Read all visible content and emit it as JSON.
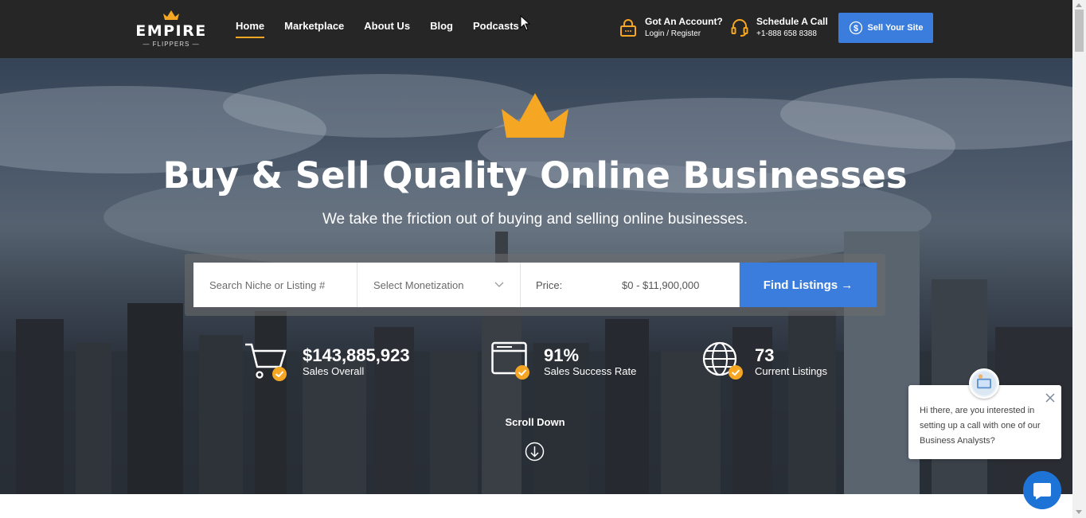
{
  "brand": {
    "name": "EMPIRE",
    "tagline": "— FLIPPERS —",
    "accent": "#f5a623",
    "primary": "#3b7ddd"
  },
  "nav": {
    "links": [
      {
        "label": "Home",
        "active": true
      },
      {
        "label": "Marketplace",
        "active": false
      },
      {
        "label": "About Us",
        "active": false
      },
      {
        "label": "Blog",
        "active": false
      },
      {
        "label": "Podcasts",
        "active": false
      }
    ],
    "account": {
      "title": "Got An Account?",
      "sub": "Login / Register",
      "icon": "lock-icon"
    },
    "call": {
      "title": "Schedule A Call",
      "sub": "+1-888 658 8388",
      "icon": "headset-icon"
    },
    "sell_button": "Sell Your Site"
  },
  "hero": {
    "title": "Buy & Sell Quality Online Businesses",
    "subtitle": "We take the friction out of buying and selling online businesses."
  },
  "search": {
    "placeholder": "Search Niche or Listing #",
    "monetization": "Select Monetization",
    "price_label": "Price:",
    "price_range": "$0 - $11,900,000",
    "button": "Find Listings →"
  },
  "stats": [
    {
      "value": "$143,885,923",
      "label": "Sales Overall",
      "icon": "cart-icon"
    },
    {
      "value": "91%",
      "label": "Sales Success Rate",
      "icon": "browser-icon"
    },
    {
      "value": "73",
      "label": "Current Listings",
      "icon": "globe-icon"
    }
  ],
  "scroll": {
    "label": "Scroll Down"
  },
  "chat": {
    "message": "Hi there, are you interested in setting up a call with one of our Business Analysts?"
  }
}
